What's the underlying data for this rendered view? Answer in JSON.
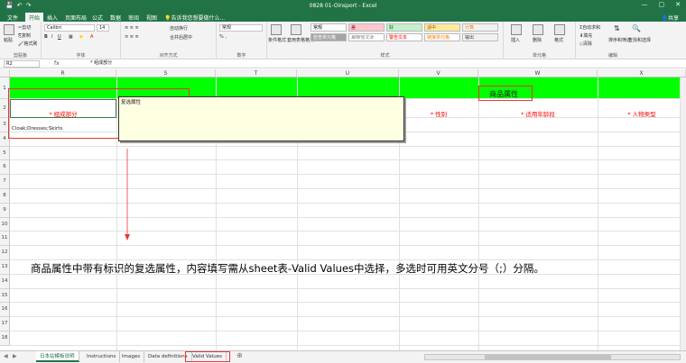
{
  "window": {
    "title": "0828 01-Oinsport - Excel",
    "minimize": "—",
    "restore": "▢",
    "close": "✕"
  },
  "qat": {
    "save": "💾",
    "undo": "↶",
    "redo": "↷"
  },
  "tabs": [
    "文件",
    "开始",
    "插入",
    "页面布局",
    "公式",
    "数据",
    "审阅",
    "视图"
  ],
  "tell_me": "告诉我您想要做什么...",
  "share": "共享",
  "ribbon": {
    "clipboard": {
      "label": "剪贴板",
      "paste": "粘贴",
      "cut": "剪切",
      "copy": "复制",
      "format_painter": "格式刷"
    },
    "font": {
      "label": "字体",
      "name": "Calibri",
      "size": "14"
    },
    "alignment": {
      "label": "对齐方式",
      "wrap": "自动换行",
      "merge": "合并后居中"
    },
    "number": {
      "label": "数字",
      "format": "常规"
    },
    "styles": {
      "label": "样式",
      "conditional": "条件格式",
      "table": "套用表格格式",
      "cells": [
        {
          "text": "常规",
          "bg": "#ffffff",
          "fg": "#000000"
        },
        {
          "text": "差",
          "bg": "#ffc7ce",
          "fg": "#9c0006"
        },
        {
          "text": "好",
          "bg": "#c6efce",
          "fg": "#006100"
        },
        {
          "text": "适中",
          "bg": "#ffeb9c",
          "fg": "#9c5700"
        },
        {
          "text": "计算",
          "bg": "#f2f2f2",
          "fg": "#fa7d00"
        },
        {
          "text": "检查单元格",
          "bg": "#a5a5a5",
          "fg": "#ffffff"
        },
        {
          "text": "解释性文本",
          "bg": "#ffffff",
          "fg": "#7f7f7f"
        },
        {
          "text": "警告文本",
          "bg": "#ffffff",
          "fg": "#ff0000"
        },
        {
          "text": "链接单元格",
          "bg": "#ffffff",
          "fg": "#fa7d00"
        },
        {
          "text": "输出",
          "bg": "#f2f2f2",
          "fg": "#3f3f3f"
        }
      ]
    },
    "cells_group": {
      "label": "单元格",
      "insert": "插入",
      "delete": "删除",
      "format": "格式"
    },
    "editing": {
      "label": "编辑",
      "autosum": "自动求和",
      "fill": "填充",
      "clear": "清除",
      "sort": "排序和筛选",
      "find": "查找和选择"
    }
  },
  "formula_bar": {
    "name_box": "R2",
    "fx": "fx",
    "content": "* 组成部分"
  },
  "columns": [
    "R",
    "S",
    "T",
    "U",
    "V",
    "W",
    "X"
  ],
  "rows": [
    "1",
    "2",
    "3",
    "4",
    "5",
    "6",
    "7",
    "8",
    "9",
    "10",
    "11",
    "12",
    "13",
    "14",
    "15",
    "16",
    "17",
    "18"
  ],
  "cells": {
    "section_header": "商品属性",
    "r2_component": "* 组成部分",
    "v2_gender": "* 性别",
    "w2_age": "* 适用年龄段",
    "x2_persona": "* 人物类型",
    "r3_value": "Cloak;Dresses;Skirts"
  },
  "comment": {
    "text": "复选属性"
  },
  "note": "商品属性中带有标识的复选属性，内容填写需从sheet表-Valid Values中选择，多选时可用英文分号（;）分隔。",
  "sheets": [
    "日本站模板说明",
    "Instructions",
    "Images",
    "Data definitions",
    "Valid Values"
  ],
  "active_sheet_index": 0,
  "highlighted_sheet_index": 4,
  "colors": {
    "accent": "#217346",
    "band": "#00ff00",
    "required": "#ff0000",
    "highlight": "#e53935"
  }
}
